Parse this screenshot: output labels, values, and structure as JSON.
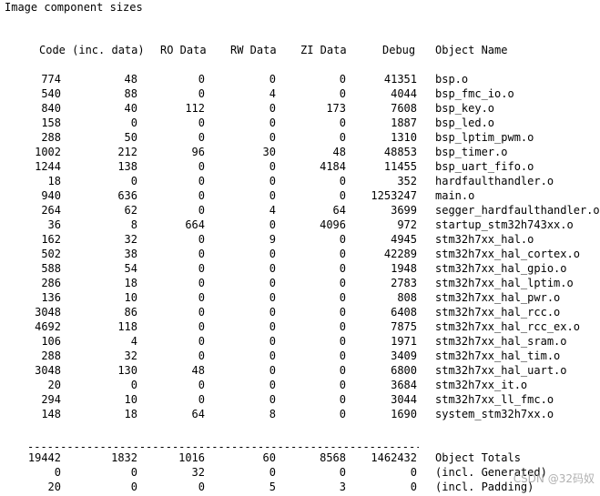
{
  "title": "Image component sizes",
  "headers": {
    "code": "Code (inc. data)",
    "ro": "RO Data",
    "rw": "RW Data",
    "zi": "ZI Data",
    "debug": "Debug",
    "name": "Object Name"
  },
  "rows": [
    {
      "code": "774",
      "data": "48",
      "ro": "0",
      "rw": "0",
      "zi": "0",
      "debug": "41351",
      "name": "bsp.o"
    },
    {
      "code": "540",
      "data": "88",
      "ro": "0",
      "rw": "4",
      "zi": "0",
      "debug": "4044",
      "name": "bsp_fmc_io.o"
    },
    {
      "code": "840",
      "data": "40",
      "ro": "112",
      "rw": "0",
      "zi": "173",
      "debug": "7608",
      "name": "bsp_key.o"
    },
    {
      "code": "158",
      "data": "0",
      "ro": "0",
      "rw": "0",
      "zi": "0",
      "debug": "1887",
      "name": "bsp_led.o"
    },
    {
      "code": "288",
      "data": "50",
      "ro": "0",
      "rw": "0",
      "zi": "0",
      "debug": "1310",
      "name": "bsp_lptim_pwm.o"
    },
    {
      "code": "1002",
      "data": "212",
      "ro": "96",
      "rw": "30",
      "zi": "48",
      "debug": "48853",
      "name": "bsp_timer.o"
    },
    {
      "code": "1244",
      "data": "138",
      "ro": "0",
      "rw": "0",
      "zi": "4184",
      "debug": "11455",
      "name": "bsp_uart_fifo.o"
    },
    {
      "code": "18",
      "data": "0",
      "ro": "0",
      "rw": "0",
      "zi": "0",
      "debug": "352",
      "name": "hardfaulthandler.o"
    },
    {
      "code": "940",
      "data": "636",
      "ro": "0",
      "rw": "0",
      "zi": "0",
      "debug": "1253247",
      "name": "main.o"
    },
    {
      "code": "264",
      "data": "62",
      "ro": "0",
      "rw": "4",
      "zi": "64",
      "debug": "3699",
      "name": "segger_hardfaulthandler.o"
    },
    {
      "code": "36",
      "data": "8",
      "ro": "664",
      "rw": "0",
      "zi": "4096",
      "debug": "972",
      "name": "startup_stm32h743xx.o"
    },
    {
      "code": "162",
      "data": "32",
      "ro": "0",
      "rw": "9",
      "zi": "0",
      "debug": "4945",
      "name": "stm32h7xx_hal.o"
    },
    {
      "code": "502",
      "data": "38",
      "ro": "0",
      "rw": "0",
      "zi": "0",
      "debug": "42289",
      "name": "stm32h7xx_hal_cortex.o"
    },
    {
      "code": "588",
      "data": "54",
      "ro": "0",
      "rw": "0",
      "zi": "0",
      "debug": "1948",
      "name": "stm32h7xx_hal_gpio.o"
    },
    {
      "code": "286",
      "data": "18",
      "ro": "0",
      "rw": "0",
      "zi": "0",
      "debug": "2783",
      "name": "stm32h7xx_hal_lptim.o"
    },
    {
      "code": "136",
      "data": "10",
      "ro": "0",
      "rw": "0",
      "zi": "0",
      "debug": "808",
      "name": "stm32h7xx_hal_pwr.o"
    },
    {
      "code": "3048",
      "data": "86",
      "ro": "0",
      "rw": "0",
      "zi": "0",
      "debug": "6408",
      "name": "stm32h7xx_hal_rcc.o"
    },
    {
      "code": "4692",
      "data": "118",
      "ro": "0",
      "rw": "0",
      "zi": "0",
      "debug": "7875",
      "name": "stm32h7xx_hal_rcc_ex.o"
    },
    {
      "code": "106",
      "data": "4",
      "ro": "0",
      "rw": "0",
      "zi": "0",
      "debug": "1971",
      "name": "stm32h7xx_hal_sram.o"
    },
    {
      "code": "288",
      "data": "32",
      "ro": "0",
      "rw": "0",
      "zi": "0",
      "debug": "3409",
      "name": "stm32h7xx_hal_tim.o"
    },
    {
      "code": "3048",
      "data": "130",
      "ro": "48",
      "rw": "0",
      "zi": "0",
      "debug": "6800",
      "name": "stm32h7xx_hal_uart.o"
    },
    {
      "code": "20",
      "data": "0",
      "ro": "0",
      "rw": "0",
      "zi": "0",
      "debug": "3684",
      "name": "stm32h7xx_it.o"
    },
    {
      "code": "294",
      "data": "10",
      "ro": "0",
      "rw": "0",
      "zi": "0",
      "debug": "3044",
      "name": "stm32h7xx_ll_fmc.o"
    },
    {
      "code": "148",
      "data": "18",
      "ro": "64",
      "rw": "8",
      "zi": "0",
      "debug": "1690",
      "name": "system_stm32h7xx.o"
    }
  ],
  "separator": "--------------------------------------------------------------------------------",
  "totals": [
    {
      "code": "19442",
      "data": "1832",
      "ro": "1016",
      "rw": "60",
      "zi": "8568",
      "debug": "1462432",
      "name": "Object Totals"
    },
    {
      "code": "0",
      "data": "0",
      "ro": "32",
      "rw": "0",
      "zi": "0",
      "debug": "0",
      "name": "(incl. Generated)"
    },
    {
      "code": "20",
      "data": "0",
      "ro": "0",
      "rw": "5",
      "zi": "3",
      "debug": "0",
      "name": "(incl. Padding)"
    }
  ],
  "watermark": "CSDN @32码奴"
}
